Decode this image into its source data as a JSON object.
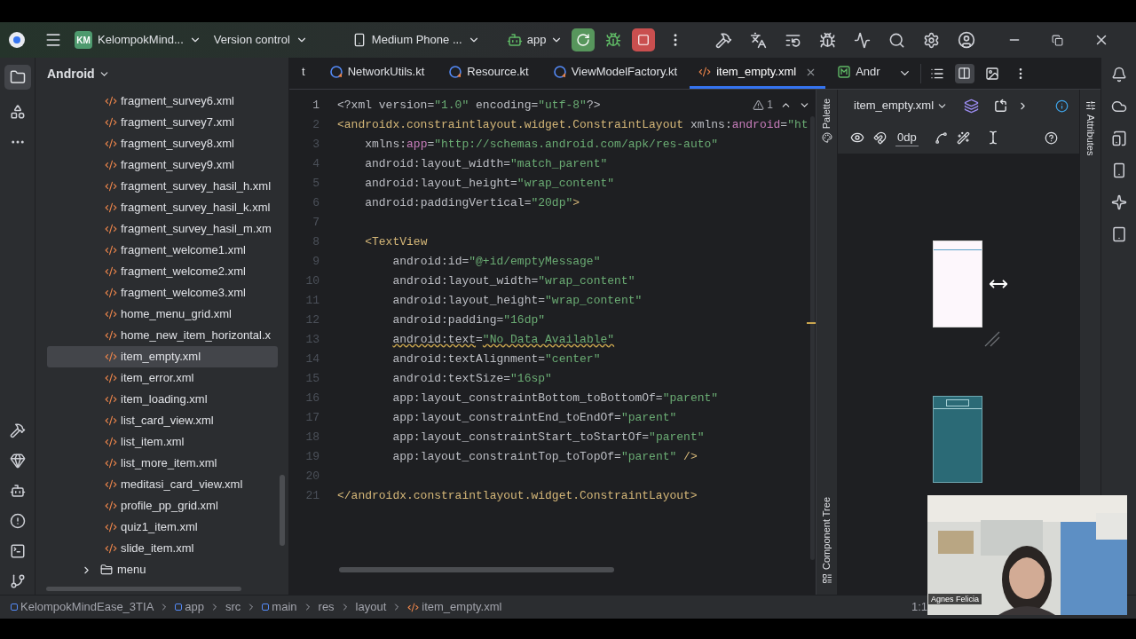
{
  "top_bar": {
    "project_badge": "KM",
    "project_name": "KelompokMind...",
    "vcs": "Version control",
    "device": "Medium Phone ...",
    "run_config": "app"
  },
  "project_panel": {
    "title": "Android",
    "items": [
      {
        "name": "fragment_survey6.xml",
        "kind": "file",
        "selected": false
      },
      {
        "name": "fragment_survey7.xml",
        "kind": "file",
        "selected": false
      },
      {
        "name": "fragment_survey8.xml",
        "kind": "file",
        "selected": false
      },
      {
        "name": "fragment_survey9.xml",
        "kind": "file",
        "selected": false
      },
      {
        "name": "fragment_survey_hasil_h.xml",
        "kind": "file",
        "selected": false
      },
      {
        "name": "fragment_survey_hasil_k.xml",
        "kind": "file",
        "selected": false
      },
      {
        "name": "fragment_survey_hasil_m.xm",
        "kind": "file",
        "selected": false
      },
      {
        "name": "fragment_welcome1.xml",
        "kind": "file",
        "selected": false
      },
      {
        "name": "fragment_welcome2.xml",
        "kind": "file",
        "selected": false
      },
      {
        "name": "fragment_welcome3.xml",
        "kind": "file",
        "selected": false
      },
      {
        "name": "home_menu_grid.xml",
        "kind": "file",
        "selected": false
      },
      {
        "name": "home_new_item_horizontal.x",
        "kind": "file",
        "selected": false
      },
      {
        "name": "item_empty.xml",
        "kind": "file",
        "selected": true
      },
      {
        "name": "item_error.xml",
        "kind": "file",
        "selected": false
      },
      {
        "name": "item_loading.xml",
        "kind": "file",
        "selected": false
      },
      {
        "name": "list_card_view.xml",
        "kind": "file",
        "selected": false
      },
      {
        "name": "list_item.xml",
        "kind": "file",
        "selected": false
      },
      {
        "name": "list_more_item.xml",
        "kind": "file",
        "selected": false
      },
      {
        "name": "meditasi_card_view.xml",
        "kind": "file",
        "selected": false
      },
      {
        "name": "profile_pp_grid.xml",
        "kind": "file",
        "selected": false
      },
      {
        "name": "quiz1_item.xml",
        "kind": "file",
        "selected": false
      },
      {
        "name": "slide_item.xml",
        "kind": "file",
        "selected": false
      },
      {
        "name": "menu",
        "kind": "folder",
        "selected": false,
        "expanded": false
      }
    ]
  },
  "tabs": [
    {
      "label": "t",
      "kind": "cut",
      "selected": false
    },
    {
      "label": "NetworkUtils.kt",
      "kind": "kotlin",
      "selected": false
    },
    {
      "label": "Resource.kt",
      "kind": "kotlin",
      "selected": false
    },
    {
      "label": "ViewModelFactory.kt",
      "kind": "kotlin",
      "selected": false
    },
    {
      "label": "item_empty.xml",
      "kind": "xml",
      "selected": true
    },
    {
      "label": "Andr",
      "kind": "manifest",
      "selected": false
    }
  ],
  "editor": {
    "warnings": "1",
    "lines": [
      {
        "number": "1",
        "segments": [
          {
            "kind": "plain",
            "text": "<?xml version="
          },
          {
            "kind": "value",
            "text": "\"1.0\""
          },
          {
            "kind": "plain",
            "text": " encoding="
          },
          {
            "kind": "value",
            "text": "\"utf-8\""
          },
          {
            "kind": "plain",
            "text": "?>"
          }
        ]
      },
      {
        "number": "2",
        "segments": [
          {
            "kind": "tag",
            "text": "<androidx.constraintlayout.widget.ConstraintLayout"
          },
          {
            "kind": "plain",
            "text": " xmlns:"
          },
          {
            "kind": "ns",
            "text": "android"
          },
          {
            "kind": "plain",
            "text": "="
          },
          {
            "kind": "value",
            "text": "\"ht"
          }
        ]
      },
      {
        "number": "3",
        "segments": [
          {
            "kind": "plain",
            "text": "    xmlns:"
          },
          {
            "kind": "ns",
            "text": "app"
          },
          {
            "kind": "plain",
            "text": "="
          },
          {
            "kind": "value",
            "text": "\"http://schemas.android.com/apk/res-auto\""
          }
        ]
      },
      {
        "number": "4",
        "segments": [
          {
            "kind": "plain",
            "text": "    android:layout_width="
          },
          {
            "kind": "value",
            "text": "\"match_parent\""
          }
        ]
      },
      {
        "number": "5",
        "segments": [
          {
            "kind": "plain",
            "text": "    android:layout_height="
          },
          {
            "kind": "value",
            "text": "\"wrap_content\""
          }
        ]
      },
      {
        "number": "6",
        "segments": [
          {
            "kind": "plain",
            "text": "    android:paddingVertical="
          },
          {
            "kind": "value",
            "text": "\"20dp\""
          },
          {
            "kind": "tag",
            "text": ">"
          }
        ]
      },
      {
        "number": "7"
      },
      {
        "number": "8",
        "segments": [
          {
            "kind": "tag",
            "text": "    <TextView"
          }
        ]
      },
      {
        "number": "9",
        "segments": [
          {
            "kind": "plain",
            "text": "        android:id="
          },
          {
            "kind": "value",
            "text": "\"@+id/emptyMessage\""
          }
        ]
      },
      {
        "number": "10",
        "segments": [
          {
            "kind": "plain",
            "text": "        android:layout_width="
          },
          {
            "kind": "value",
            "text": "\"wrap_content\""
          }
        ]
      },
      {
        "number": "11",
        "segments": [
          {
            "kind": "plain",
            "text": "        android:layout_height="
          },
          {
            "kind": "value",
            "text": "\"wrap_content\""
          }
        ]
      },
      {
        "number": "12",
        "segments": [
          {
            "kind": "plain",
            "text": "        android:padding="
          },
          {
            "kind": "value",
            "text": "\"16dp\""
          }
        ]
      },
      {
        "number": "13",
        "segments": [
          {
            "kind": "warn",
            "text": "        android:text"
          },
          {
            "kind": "plain",
            "text": "="
          },
          {
            "kind": "warnvalue",
            "text": "\"No Data Available\""
          }
        ]
      },
      {
        "number": "14",
        "segments": [
          {
            "kind": "plain",
            "text": "        android:textAlignment="
          },
          {
            "kind": "value",
            "text": "\"center\""
          }
        ]
      },
      {
        "number": "15",
        "segments": [
          {
            "kind": "plain",
            "text": "        android:textSize="
          },
          {
            "kind": "value",
            "text": "\"16sp\""
          }
        ]
      },
      {
        "number": "16",
        "segments": [
          {
            "kind": "plain",
            "text": "        app:layout_constraintBottom_toBottomOf="
          },
          {
            "kind": "value",
            "text": "\"parent\""
          }
        ]
      },
      {
        "number": "17",
        "segments": [
          {
            "kind": "plain",
            "text": "        app:layout_constraintEnd_toEndOf="
          },
          {
            "kind": "value",
            "text": "\"parent\""
          }
        ]
      },
      {
        "number": "18",
        "segments": [
          {
            "kind": "plain",
            "text": "        app:layout_constraintStart_toStartOf="
          },
          {
            "kind": "value",
            "text": "\"parent\""
          }
        ]
      },
      {
        "number": "19",
        "segments": [
          {
            "kind": "plain",
            "text": "        app:layout_constraintTop_toTopOf="
          },
          {
            "kind": "value",
            "text": "\"parent\""
          },
          {
            "kind": "tag",
            "text": " />"
          }
        ]
      },
      {
        "number": "20"
      },
      {
        "number": "21",
        "segments": [
          {
            "kind": "tag",
            "text": "</androidx.constraintlayout.widget.ConstraintLayout>"
          }
        ]
      }
    ]
  },
  "design": {
    "file": "item_empty.xml",
    "margin": "0dp",
    "palette": "Palette",
    "component_tree": "Component Tree",
    "attributes": "Attributes"
  },
  "breadcrumbs": [
    {
      "label": "KelompokMindEase_3TIA",
      "kind": "module"
    },
    {
      "label": "app",
      "kind": "module"
    },
    {
      "label": "src",
      "kind": "dir"
    },
    {
      "label": "main",
      "kind": "module"
    },
    {
      "label": "res",
      "kind": "dir"
    },
    {
      "label": "layout",
      "kind": "dir"
    },
    {
      "label": "item_empty.xml",
      "kind": "xml"
    }
  ],
  "status": {
    "position": "1:1"
  },
  "webcam": {
    "name": "Agnes Felicia"
  }
}
